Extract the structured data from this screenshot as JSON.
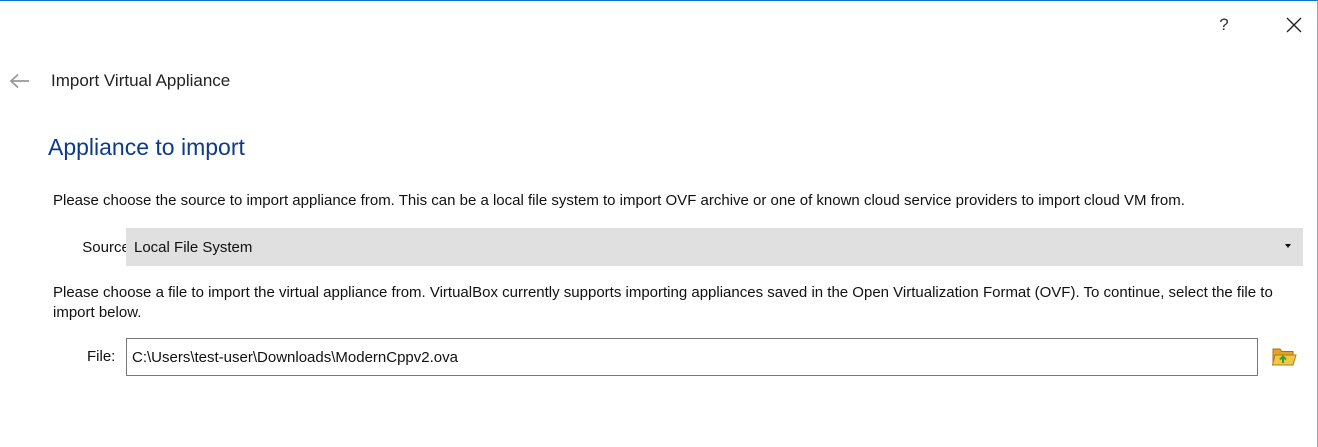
{
  "window": {
    "help_label": "?",
    "close_icon": "close-icon"
  },
  "header": {
    "back_icon": "arrow-left-icon",
    "title": "Import Virtual Appliance"
  },
  "page": {
    "section_title": "Appliance to import",
    "source_description": "Please choose the source to import appliance from. This can be a local file system to import OVF archive or one of known cloud service providers to import cloud VM from.",
    "source_label": "Source:",
    "source_value": "Local File System",
    "file_description": "Please choose a file to import the virtual appliance from. VirtualBox currently supports importing appliances saved in the Open Virtualization Format (OVF). To continue, select the file to import below.",
    "file_label": "File:",
    "file_value": "C:\\Users\\test-user\\Downloads\\ModernCppv2.ova",
    "folder_icon": "folder-open-icon"
  },
  "colors": {
    "accent_title": "#0d3a8a",
    "window_border": "#0b6fd6",
    "select_bg": "#e0e0e0"
  }
}
